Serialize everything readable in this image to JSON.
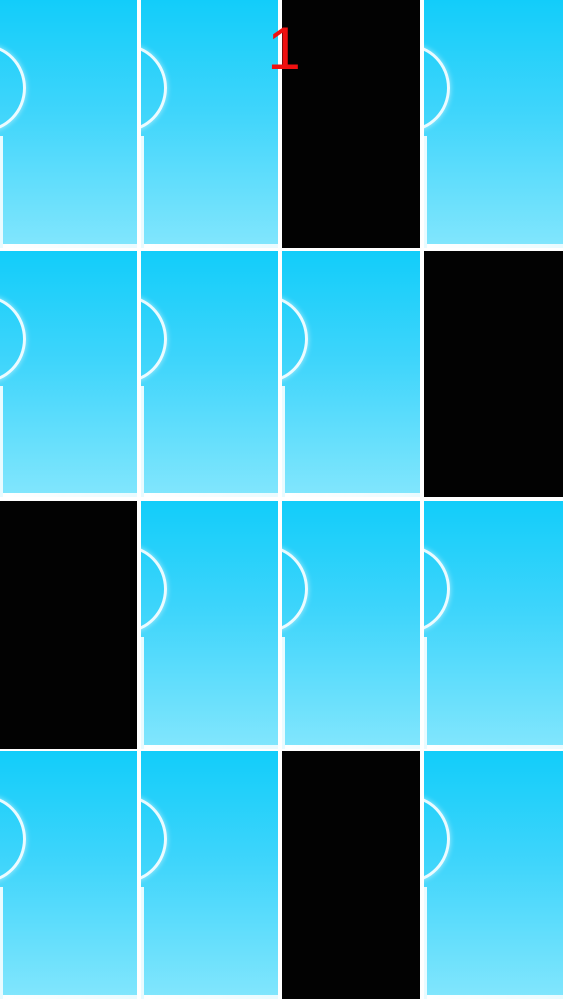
{
  "score": "1",
  "colors": {
    "score": "#f01010",
    "black_tile": "#020202",
    "blue_tile_top": "#12cdfa",
    "blue_tile_bottom": "#82e6fd",
    "gap": "#ffffff"
  },
  "grid": {
    "rows": [
      [
        "blue",
        "blue",
        "black",
        "blue"
      ],
      [
        "blue",
        "blue",
        "blue",
        "black"
      ],
      [
        "black",
        "blue",
        "blue",
        "blue"
      ],
      [
        "blue",
        "blue",
        "black",
        "blue"
      ]
    ]
  }
}
